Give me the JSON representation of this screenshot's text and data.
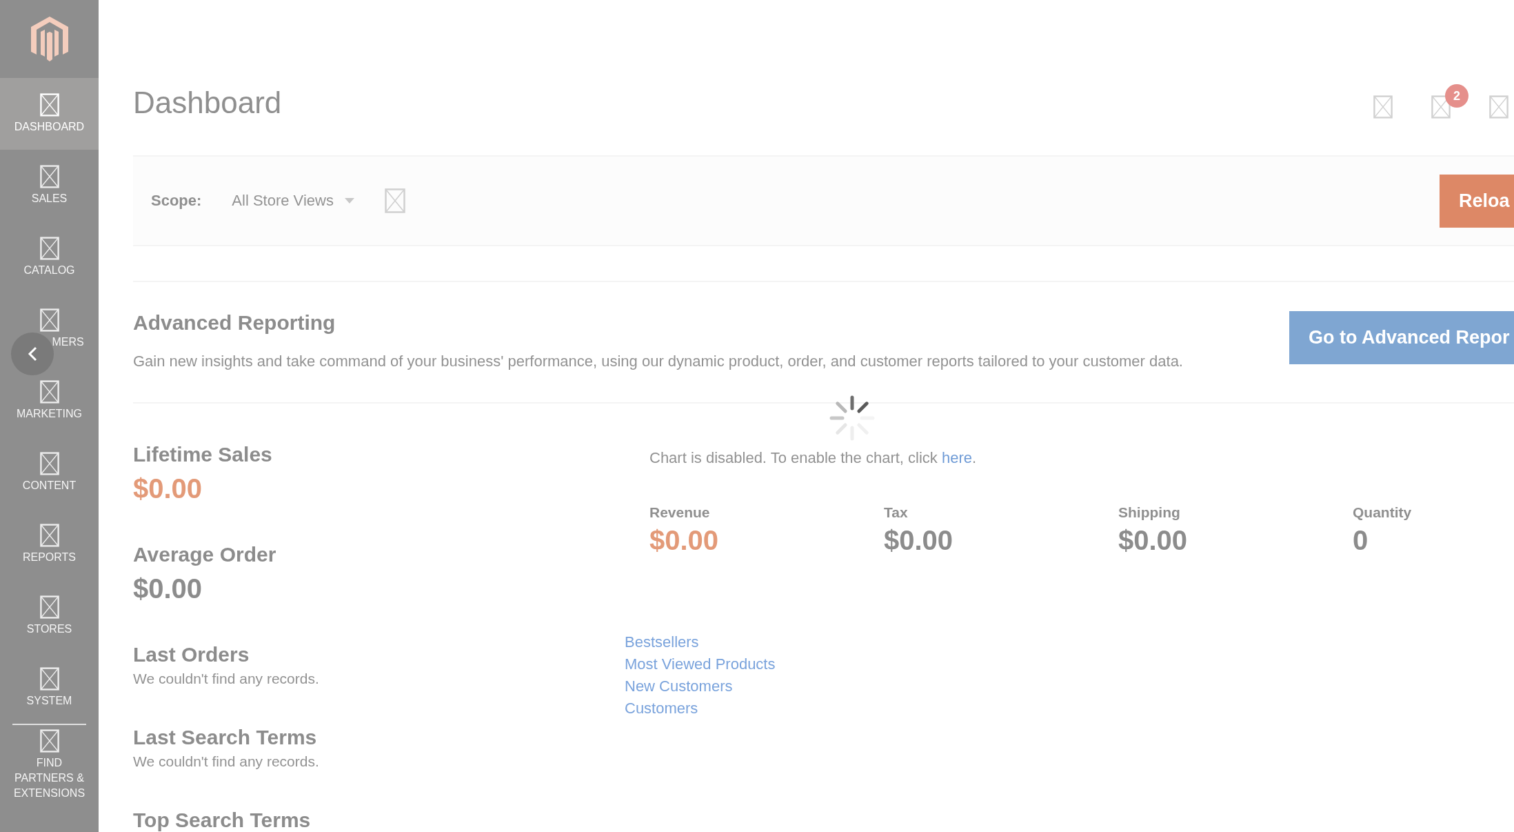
{
  "sidebar": {
    "items": [
      {
        "label": "DASHBOARD",
        "selected": true
      },
      {
        "label": "SALES",
        "selected": false
      },
      {
        "label": "CATALOG",
        "selected": false
      },
      {
        "label": "MERS",
        "covered": true,
        "selected": false
      },
      {
        "label": "MARKETING",
        "selected": false
      },
      {
        "label": "CONTENT",
        "selected": false
      },
      {
        "label": "REPORTS",
        "selected": false
      },
      {
        "label": "STORES",
        "selected": false
      },
      {
        "label": "SYSTEM",
        "selected": false
      },
      {
        "label": "FIND PARTNERS & EXTENSIONS",
        "selected": false
      }
    ]
  },
  "header": {
    "title": "Dashboard",
    "notification_count": "2"
  },
  "scope": {
    "label": "Scope:",
    "value": "All Store Views"
  },
  "reload_button": "Reloa",
  "advanced_reporting": {
    "title": "Advanced Reporting",
    "description": "Gain new insights and take command of your business' performance, using our dynamic product, order, and customer reports tailored to your customer data.",
    "button": "Go to Advanced Repor"
  },
  "left_sections": [
    {
      "kind": "stat",
      "title": "Lifetime Sales",
      "value": "$0.00",
      "highlight": true
    },
    {
      "kind": "stat",
      "title": "Average Order",
      "value": "$0.00",
      "highlight": false
    },
    {
      "kind": "empty",
      "title": "Last Orders",
      "text": "We couldn't find any records."
    },
    {
      "kind": "empty",
      "title": "Last Search Terms",
      "text": "We couldn't find any records."
    },
    {
      "kind": "heading",
      "title": "Top Search Terms"
    }
  ],
  "chart_notice": {
    "text": "Chart is disabled. To enable the chart, click ",
    "link": "here",
    "end": "."
  },
  "totals": [
    {
      "label": "Revenue",
      "value": "$0.00",
      "highlight": true
    },
    {
      "label": "Tax",
      "value": "$0.00",
      "highlight": false
    },
    {
      "label": "Shipping",
      "value": "$0.00",
      "highlight": false
    },
    {
      "label": "Quantity",
      "value": "0",
      "highlight": false
    }
  ],
  "tabs": [
    {
      "label": "Bestsellers"
    },
    {
      "label": "Most Viewed Products"
    },
    {
      "label": "New Customers"
    },
    {
      "label": "Customers"
    }
  ]
}
